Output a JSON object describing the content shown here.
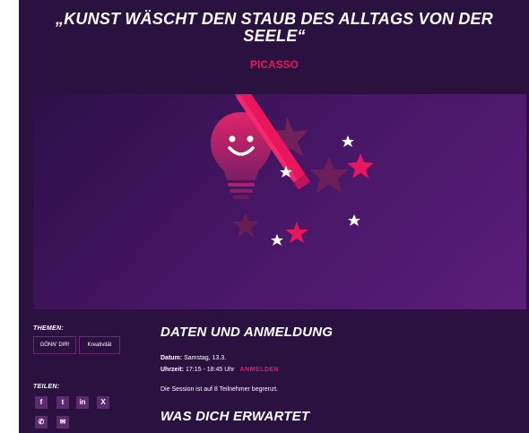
{
  "quote": {
    "line1": "„KUNST WÄSCHT DEN STAUB DES ALLTAGS VON DER",
    "line2": "SEELE“",
    "author": "PICASSO"
  },
  "hero": {
    "icon": "lightbulb-wand-illustration"
  },
  "themen": {
    "label": "THEMEN:",
    "tags": [
      "GÖNN' DIR!",
      "Kreativität"
    ]
  },
  "teilen": {
    "label": "TEILEN:",
    "icons": [
      "facebook-icon",
      "twitter-icon",
      "linkedin-icon",
      "xing-icon",
      "whatsapp-icon",
      "email-icon"
    ],
    "glyphs": [
      "f",
      "t",
      "in",
      "X",
      "✆",
      "✉"
    ]
  },
  "daten": {
    "heading": "DATEN UND ANMELDUNG",
    "datum_label": "Datum:",
    "datum_value": "Samstag, 13.3.",
    "uhrzeit_label": "Uhrzeit:",
    "uhrzeit_value": "17:15 - 18:45 Uhr",
    "anmelden": "ANMELDEN",
    "note": "Die Session ist auf 8 Teilnehmer begrenzt."
  },
  "erwartet": {
    "heading": "WAS DICH ERWARTET"
  },
  "colors": {
    "accent": "#e8175d",
    "background": "#2a1140",
    "hero": "#4a1769"
  }
}
